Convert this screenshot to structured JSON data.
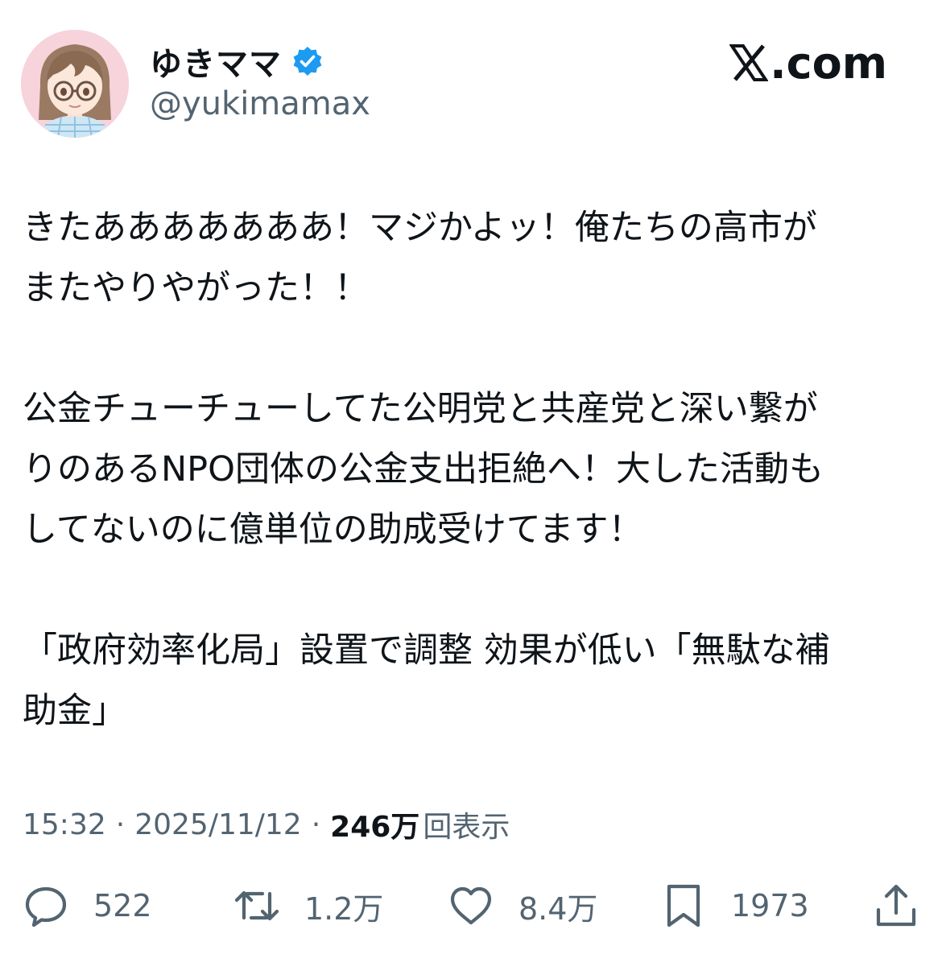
{
  "user": {
    "display_name": "ゆきママ",
    "handle": "@yukimamax",
    "verified_icon": "verified-badge-icon",
    "avatar_icon": "avatar"
  },
  "brand": {
    "logo_text": ".com",
    "logo_icon": "x-logo-icon"
  },
  "post": {
    "paragraphs": [
      "きたあああああああ！マジかよッ！俺たちの高市が\nまたやりやがった！！",
      "公金チューチューしてた公明党と共産党と深い繋が\nりのあるNPO団体の公金支出拒絶へ！大した活動も\nしてないのに億単位の助成受けてます！",
      "「政府効率化局」設置で調整 効果が低い「無駄な補\n助金」"
    ]
  },
  "meta": {
    "time": "15:32",
    "date": "2025/11/12",
    "separator": "·",
    "views_count": "246万",
    "views_label": "回表示"
  },
  "actions": {
    "replies": "522",
    "reposts": "1.2万",
    "likes": "8.4万",
    "bookmarks": "1973"
  },
  "colors": {
    "text": "#0f1419",
    "secondary": "#536471",
    "verified": "#1d9bf0",
    "avatar_bg": "#f7d3dc"
  }
}
